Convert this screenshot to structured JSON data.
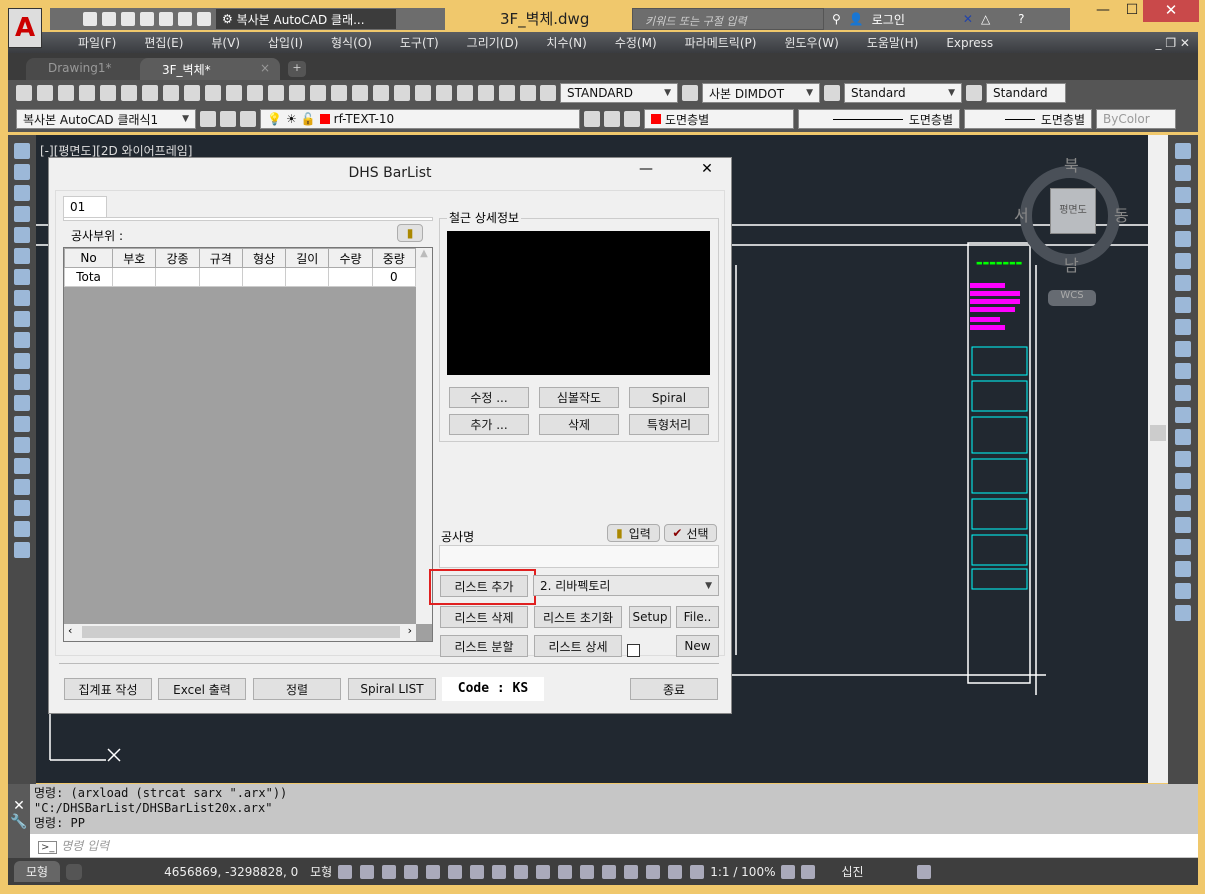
{
  "window": {
    "title": "3F_벽체.dwg",
    "minimize": "—",
    "maximize": "☐",
    "close": "✕"
  },
  "app_logo": "A",
  "qat": {
    "workspace": "복사본 AutoCAD 클래...",
    "icons": [
      "new-icon",
      "open-icon",
      "save-icon",
      "save-as-icon",
      "print-icon",
      "undo-icon",
      "redo-icon"
    ]
  },
  "search": {
    "placeholder": "키워드 또는 구절 입력"
  },
  "user": {
    "login": "로그인"
  },
  "menu": [
    "파일(F)",
    "편집(E)",
    "뷰(V)",
    "삽입(I)",
    "형식(O)",
    "도구(T)",
    "그리기(D)",
    "치수(N)",
    "수정(M)",
    "파라메트릭(P)",
    "윈도우(W)",
    "도움말(H)",
    "Express"
  ],
  "tabs": [
    {
      "label": "Drawing1*",
      "active": false
    },
    {
      "label": "3F_벽체*",
      "active": true
    }
  ],
  "toolbar1": {
    "text_style": "STANDARD",
    "dim_style": "사본 DIMDOT",
    "table_style": "Standard",
    "mleader_style": "Standard"
  },
  "toolbar2": {
    "workspace": "복사본 AutoCAD 클래식1",
    "layer": "rf-TEXT-10",
    "color": "도면층별",
    "linetype": "도면층별",
    "lineweight": "도면층별",
    "plotstyle": "ByColor",
    "layer_color": "#ff0000"
  },
  "viewport_label": "[-][평면도][2D 와이어프레임]",
  "viewcube": {
    "north": "북",
    "south": "남",
    "east": "동",
    "west": "서",
    "face": "평면도",
    "ucs": "WCS"
  },
  "dialog": {
    "title": "DHS BarList",
    "tab": "01",
    "site_label": "공사부위 :",
    "columns": [
      "No",
      "부호",
      "강종",
      "규격",
      "형상",
      "길이",
      "수량",
      "중량"
    ],
    "rows": [
      [
        "Tota",
        "",
        "",
        "",
        "",
        "",
        "",
        "0"
      ]
    ],
    "detail_group": "철근 상세정보",
    "detail_buttons": [
      "수정 ...",
      "심볼작도",
      "Spiral",
      "추가 ...",
      "삭제",
      "특형처리"
    ],
    "project_label": "공사명",
    "input_button": "입력",
    "select_button": "선택",
    "project_value": "",
    "list_add": "리스트 추가",
    "list_type": "2. 리바펙토리",
    "list_delete": "리스트 삭제",
    "list_reset": "리스트 초기화",
    "setup": "Setup",
    "file": "File..",
    "list_split": "리스트 분할",
    "list_detail": "리스트 상세",
    "new": "New",
    "checkbox_checked": false,
    "bottom_buttons": [
      "집계표 작성",
      "Excel 출력",
      "정렬",
      "Spiral LIST"
    ],
    "code": "Code : KS",
    "close": "종료",
    "highlight_color": "#e02020"
  },
  "command": {
    "history": [
      "명령: (arxload (strcat sarx \".arx\"))",
      "\"C:/DHSBarList/DHSBarList20x.arx\"",
      "명령: PP"
    ],
    "placeholder": "명령 입력"
  },
  "status": {
    "model_tab": "모형",
    "coords": "4656869, -3298828, 0",
    "space": "모형",
    "scale": "1:1 / 100%",
    "units": "십진"
  }
}
